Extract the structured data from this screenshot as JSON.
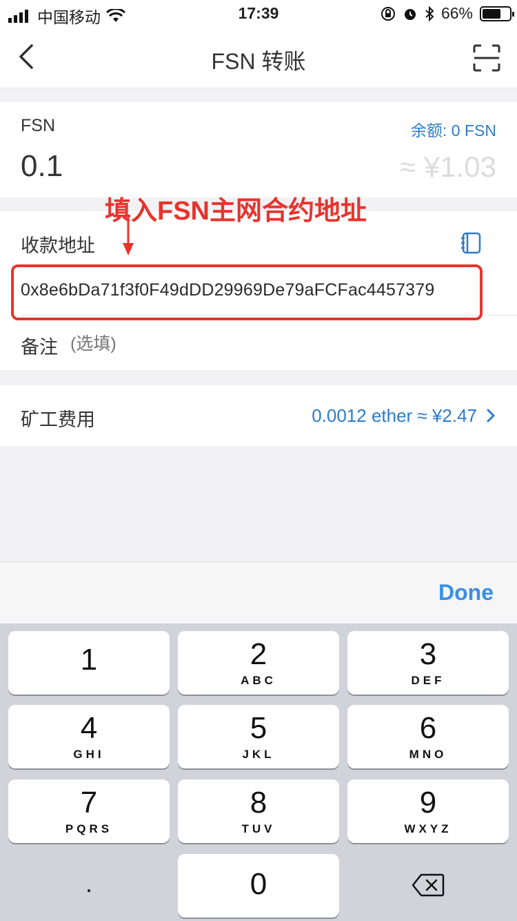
{
  "status_bar": {
    "carrier": "中国移动",
    "time": "17:39",
    "battery": "66%"
  },
  "nav": {
    "title": "FSN 转账",
    "back_icon": "chevron-left-icon",
    "scan_icon": "scan-icon"
  },
  "amount": {
    "token": "FSN",
    "balance": "余额: 0 FSN",
    "value": "0.1",
    "fiat": "≈ ¥1.03"
  },
  "address": {
    "label": "收款地址",
    "value": "0x8e6bDa71f3f0F49dDD29969De79aFCFac4457379",
    "book_icon": "address-book-icon"
  },
  "memo": {
    "label": "备注",
    "placeholder": "(选填)"
  },
  "fee": {
    "label": "矿工费用",
    "value": "0.0012 ether ≈ ¥2.47"
  },
  "annotation": {
    "text": "填入FSN主网合约地址",
    "color": "#e8332d"
  },
  "keyboard": {
    "done_label": "Done",
    "keys": [
      {
        "num": "1",
        "letters": ""
      },
      {
        "num": "2",
        "letters": "ABC"
      },
      {
        "num": "3",
        "letters": "DEF"
      },
      {
        "num": "4",
        "letters": "GHI"
      },
      {
        "num": "5",
        "letters": "JKL"
      },
      {
        "num": "6",
        "letters": "MNO"
      },
      {
        "num": "7",
        "letters": "PQRS"
      },
      {
        "num": "8",
        "letters": "TUV"
      },
      {
        "num": "9",
        "letters": "WXYZ"
      }
    ],
    "decimal": ".",
    "zero": "0",
    "delete_icon": "backspace-icon"
  },
  "colors": {
    "accent": "#2d7bc8",
    "done": "#3a8ee6",
    "background": "#f2f2f4"
  }
}
